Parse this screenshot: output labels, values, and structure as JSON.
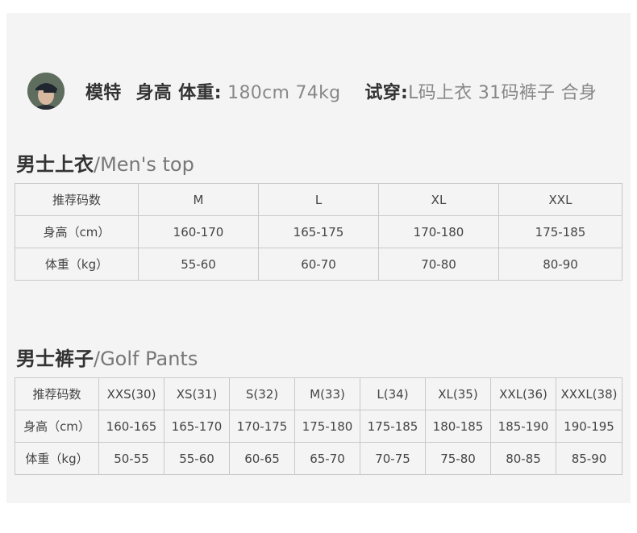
{
  "model": {
    "label": "模特",
    "height_weight_label": "身高 体重:",
    "height_weight_value": "180cm 74kg",
    "try_label": "试穿:",
    "try_value": "L码上衣 31码裤子 合身"
  },
  "top": {
    "title_zh": "男士上衣",
    "title_en": "/Men's top",
    "header": [
      "推荐码数",
      "M",
      "L",
      "XL",
      "XXL"
    ],
    "rows": [
      [
        "身高（cm）",
        "160-170",
        "165-175",
        "170-180",
        "175-185"
      ],
      [
        "体重（kg）",
        "55-60",
        "60-70",
        "70-80",
        "80-90"
      ]
    ]
  },
  "pants": {
    "title_zh": "男士裤子",
    "title_en": "/Golf Pants",
    "header": [
      "推荐码数",
      "XXS(30)",
      "XS(31)",
      "S(32)",
      "M(33)",
      "L(34)",
      "XL(35)",
      "XXL(36)",
      "XXXL(38)"
    ],
    "rows": [
      [
        "身高（cm）",
        "160-165",
        "165-170",
        "170-175",
        "175-180",
        "175-185",
        "180-185",
        "185-190",
        "190-195"
      ],
      [
        "体重（kg）",
        "50-55",
        "55-60",
        "60-65",
        "65-70",
        "70-75",
        "75-80",
        "80-85",
        "85-90"
      ]
    ]
  }
}
